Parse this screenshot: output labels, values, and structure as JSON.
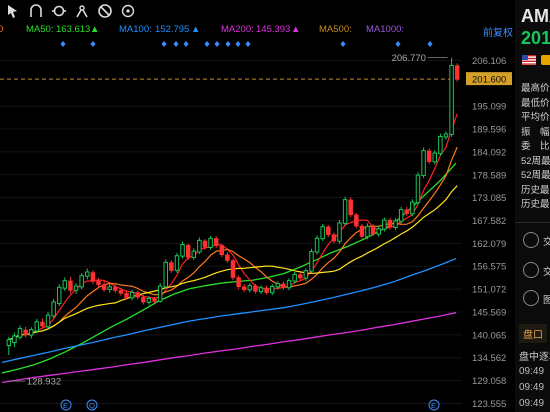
{
  "toolbar": {
    "icons": [
      "cursor-icon",
      "arch-icon",
      "ring-icon",
      "compass-icon",
      "no-entry-icon",
      "aim-icon"
    ]
  },
  "ma": {
    "ma10_value": "0",
    "ma50_label": "MA50:",
    "ma50_value": "163.613",
    "ma100_label": "MA100:",
    "ma100_value": "152.795",
    "ma200_label": "MA200:",
    "ma200_value": "145.393",
    "ma500_label": "MA500:",
    "ma1000_label": "MA1000:",
    "restore_label": "前复权"
  },
  "colors": {
    "up": "#18c65a",
    "down": "#ff3030",
    "ma5": "#ff2020",
    "ma10": "#ff7a1a",
    "ma20": "#ffe41a",
    "ma50": "#28e028",
    "ma100": "#1e90ff",
    "ma200": "#e030e0",
    "ma500": "#c78a1a",
    "ma1000": "#9b59d6"
  },
  "axis": {
    "ticks": [
      "206.106",
      "201.600",
      "195.099",
      "189.596",
      "184.092",
      "178.589",
      "173.085",
      "167.582",
      "162.079",
      "156.575",
      "151.072",
      "145.569",
      "140.065",
      "134.562",
      "129.058",
      "123.555"
    ],
    "high_label": "206.770",
    "low_label": "128.932",
    "current_price": "201.600"
  },
  "chart_data": {
    "type": "candlestick",
    "ylim": [
      121.5,
      211.5
    ],
    "current_price": 201.6,
    "period_high": 206.77,
    "period_low": 128.932,
    "candles": [
      [
        137.5,
        138.9,
        135.2,
        139.6
      ],
      [
        138.2,
        139.8,
        137.1,
        140.6
      ],
      [
        139.5,
        141.6,
        138.9,
        142.3
      ],
      [
        141.2,
        140.1,
        139.4,
        142.0
      ],
      [
        140.0,
        141.3,
        139.2,
        141.9
      ],
      [
        141.0,
        143.2,
        140.4,
        143.9
      ],
      [
        143.1,
        142.2,
        141.6,
        144.0
      ],
      [
        142.0,
        144.8,
        141.5,
        145.6
      ],
      [
        144.6,
        148.0,
        144.1,
        148.7
      ],
      [
        147.6,
        151.5,
        147.0,
        152.3
      ],
      [
        151.3,
        153.1,
        150.6,
        153.9
      ],
      [
        153.0,
        150.8,
        150.1,
        154.0
      ],
      [
        150.8,
        151.8,
        149.9,
        152.5
      ],
      [
        151.6,
        154.3,
        151.0,
        154.9
      ],
      [
        154.2,
        155.2,
        153.4,
        156.0
      ],
      [
        155.0,
        153.0,
        152.3,
        155.6
      ],
      [
        153.0,
        152.2,
        151.5,
        153.8
      ],
      [
        152.1,
        151.0,
        150.4,
        153.0
      ],
      [
        151.0,
        151.6,
        150.2,
        152.3
      ],
      [
        151.5,
        150.8,
        150.2,
        152.2
      ],
      [
        150.7,
        150.1,
        149.5,
        151.4
      ],
      [
        150.0,
        149.1,
        148.5,
        150.8
      ],
      [
        149.0,
        150.3,
        148.4,
        150.9
      ],
      [
        150.2,
        149.2,
        148.6,
        150.8
      ],
      [
        149.0,
        148.0,
        147.4,
        149.7
      ],
      [
        147.9,
        148.8,
        147.3,
        149.4
      ],
      [
        148.7,
        148.2,
        147.6,
        149.2
      ],
      [
        148.1,
        151.8,
        147.8,
        152.5
      ],
      [
        151.6,
        157.5,
        151.2,
        158.2
      ],
      [
        157.4,
        155.6,
        155.0,
        158.0
      ],
      [
        155.6,
        159.1,
        155.0,
        159.8
      ],
      [
        159.0,
        161.8,
        158.4,
        162.5
      ],
      [
        161.6,
        158.8,
        158.1,
        162.0
      ],
      [
        158.7,
        160.2,
        158.1,
        160.9
      ],
      [
        160.0,
        162.8,
        159.5,
        163.5
      ],
      [
        162.6,
        161.2,
        160.6,
        163.1
      ],
      [
        161.1,
        163.3,
        160.6,
        163.9
      ],
      [
        163.2,
        161.6,
        161.0,
        163.8
      ],
      [
        161.5,
        159.4,
        158.8,
        162.0
      ],
      [
        159.3,
        158.0,
        157.4,
        160.0
      ],
      [
        157.9,
        153.9,
        153.2,
        158.4
      ],
      [
        153.8,
        151.7,
        151.0,
        154.4
      ],
      [
        151.6,
        151.0,
        150.4,
        152.3
      ],
      [
        150.9,
        151.9,
        150.3,
        152.5
      ],
      [
        151.8,
        150.6,
        150.0,
        152.3
      ],
      [
        150.5,
        151.4,
        149.9,
        152.0
      ],
      [
        151.3,
        150.3,
        149.7,
        151.9
      ],
      [
        150.2,
        151.7,
        149.6,
        152.3
      ],
      [
        151.6,
        152.4,
        151.0,
        153.0
      ],
      [
        152.3,
        151.5,
        150.9,
        152.9
      ],
      [
        151.4,
        153.1,
        150.8,
        153.7
      ],
      [
        153.0,
        154.6,
        152.4,
        155.2
      ],
      [
        154.5,
        153.8,
        153.2,
        155.0
      ],
      [
        153.7,
        155.5,
        153.1,
        156.1
      ],
      [
        155.4,
        160.1,
        154.9,
        160.8
      ],
      [
        160.0,
        163.3,
        159.4,
        164.0
      ],
      [
        163.2,
        166.1,
        162.6,
        166.8
      ],
      [
        166.0,
        164.2,
        163.6,
        166.5
      ],
      [
        164.1,
        162.7,
        162.1,
        164.7
      ],
      [
        162.6,
        167.0,
        162.0,
        167.7
      ],
      [
        166.9,
        172.6,
        166.3,
        173.3
      ],
      [
        172.5,
        169.0,
        168.4,
        173.1
      ],
      [
        168.9,
        166.3,
        165.7,
        169.4
      ],
      [
        166.2,
        163.8,
        163.2,
        166.8
      ],
      [
        163.7,
        166.2,
        163.1,
        166.9
      ],
      [
        166.1,
        164.4,
        163.8,
        166.7
      ],
      [
        164.3,
        165.6,
        163.7,
        166.2
      ],
      [
        165.5,
        167.7,
        164.9,
        168.3
      ],
      [
        167.6,
        166.0,
        165.4,
        168.2
      ],
      [
        165.9,
        167.5,
        165.3,
        168.1
      ],
      [
        167.4,
        170.2,
        166.8,
        170.9
      ],
      [
        170.1,
        169.3,
        168.7,
        170.8
      ],
      [
        169.2,
        172.0,
        168.6,
        172.7
      ],
      [
        171.9,
        178.5,
        171.3,
        179.2
      ],
      [
        178.4,
        184.4,
        177.8,
        185.1
      ],
      [
        184.3,
        181.8,
        181.2,
        184.9
      ],
      [
        181.7,
        183.8,
        181.1,
        184.5
      ],
      [
        183.7,
        187.8,
        183.1,
        188.5
      ],
      [
        187.7,
        188.4,
        187.0,
        189.0
      ],
      [
        188.3,
        204.9,
        187.7,
        206.77
      ],
      [
        204.8,
        201.6,
        201.0,
        205.4
      ]
    ],
    "ma_series": [
      {
        "name": "MA50",
        "values": [
          130.9,
          131.8,
          132.8,
          134.2,
          135.9,
          137.8,
          139.9,
          142.0,
          143.9,
          146.0,
          148.2,
          149.9,
          151.2,
          151.9,
          152.5,
          152.9,
          153.2,
          153.9,
          154.8,
          156.3,
          158.0,
          159.8,
          161.2,
          162.9,
          164.8,
          166.9,
          170.1,
          173.7,
          177.2,
          181.4
        ]
      },
      {
        "name": "MA100",
        "values": [
          133.4,
          134.3,
          135.1,
          135.9,
          136.8,
          137.6,
          138.4,
          139.3,
          140.1,
          141.0,
          141.8,
          142.6,
          143.4,
          144.0,
          144.6,
          145.1,
          145.6,
          146.1,
          146.6,
          147.3,
          148.1,
          148.9,
          149.8,
          150.7,
          151.7,
          152.8,
          154.2,
          155.5,
          156.9,
          158.4
        ]
      },
      {
        "name": "MA200",
        "values": [
          128.6,
          129.2,
          129.8,
          130.3,
          130.8,
          131.3,
          131.8,
          132.3,
          132.9,
          133.4,
          134.0,
          134.6,
          135.1,
          135.7,
          136.2,
          136.7,
          137.3,
          137.8,
          138.4,
          138.9,
          139.5,
          140.1,
          140.6,
          141.2,
          141.9,
          142.5,
          143.2,
          143.9,
          144.6,
          145.4
        ]
      }
    ]
  },
  "right_panel": {
    "title": "AMA",
    "price": "201",
    "stats": [
      "最高价",
      "最低价",
      "平均价",
      "振　幅",
      "委　比",
      "52周最",
      "52周最",
      "历史最",
      "历史最"
    ],
    "icon_labels": [
      "交",
      "交",
      "图"
    ],
    "pankou": "盘口",
    "deals_title": "盘中逐笔",
    "deal_times": [
      "09:49",
      "09:49",
      "09:49"
    ]
  }
}
